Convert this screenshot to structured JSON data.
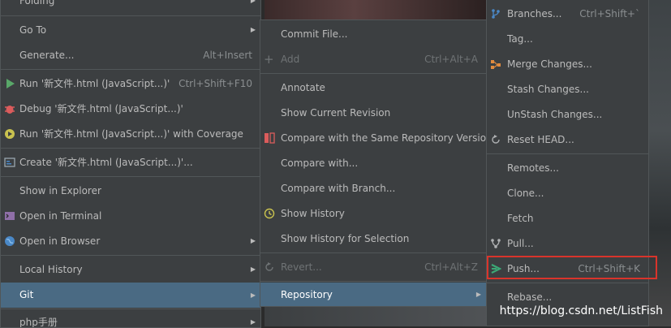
{
  "menu_left": {
    "items": [
      {
        "label": "Folding"
      },
      {
        "label": "Go To"
      },
      {
        "label": "Generate...",
        "shortcut": "Alt+Insert"
      },
      {
        "label": "Run '新文件.html (JavaScript...)'",
        "shortcut": "Ctrl+Shift+F10"
      },
      {
        "label": "Debug '新文件.html (JavaScript...)'"
      },
      {
        "label": "Run '新文件.html (JavaScript...)' with Coverage"
      },
      {
        "label": "Create '新文件.html (JavaScript...)'..."
      },
      {
        "label": "Show in Explorer"
      },
      {
        "label": "Open in Terminal"
      },
      {
        "label": "Open in Browser"
      },
      {
        "label": "Local History"
      },
      {
        "label": "Git"
      },
      {
        "label": "php手册"
      }
    ]
  },
  "menu_git": {
    "items": [
      {
        "label": "Commit File..."
      },
      {
        "label": "Add",
        "shortcut": "Ctrl+Alt+A"
      },
      {
        "label": "Annotate"
      },
      {
        "label": "Show Current Revision"
      },
      {
        "label": "Compare with the Same Repository Version"
      },
      {
        "label": "Compare with..."
      },
      {
        "label": "Compare with Branch..."
      },
      {
        "label": "Show History"
      },
      {
        "label": "Show History for Selection"
      },
      {
        "label": "Revert...",
        "shortcut": "Ctrl+Alt+Z"
      },
      {
        "label": "Repository"
      }
    ]
  },
  "menu_repo": {
    "items": [
      {
        "label": "Branches...",
        "shortcut": "Ctrl+Shift+`"
      },
      {
        "label": "Tag..."
      },
      {
        "label": "Merge Changes..."
      },
      {
        "label": "Stash Changes..."
      },
      {
        "label": "UnStash Changes..."
      },
      {
        "label": "Reset HEAD..."
      },
      {
        "label": "Remotes..."
      },
      {
        "label": "Clone..."
      },
      {
        "label": "Fetch"
      },
      {
        "label": "Pull..."
      },
      {
        "label": "Push...",
        "shortcut": "Ctrl+Shift+K"
      },
      {
        "label": "Rebase..."
      }
    ]
  },
  "watermark": "https://blog.csdn.net/ListFish",
  "colors": {
    "menu_bg": "#3c3f41",
    "selected_bg": "#4a6a83",
    "highlight_border": "#d9342b",
    "text": "#bbbbbb",
    "shortcut": "#8a8e90"
  }
}
